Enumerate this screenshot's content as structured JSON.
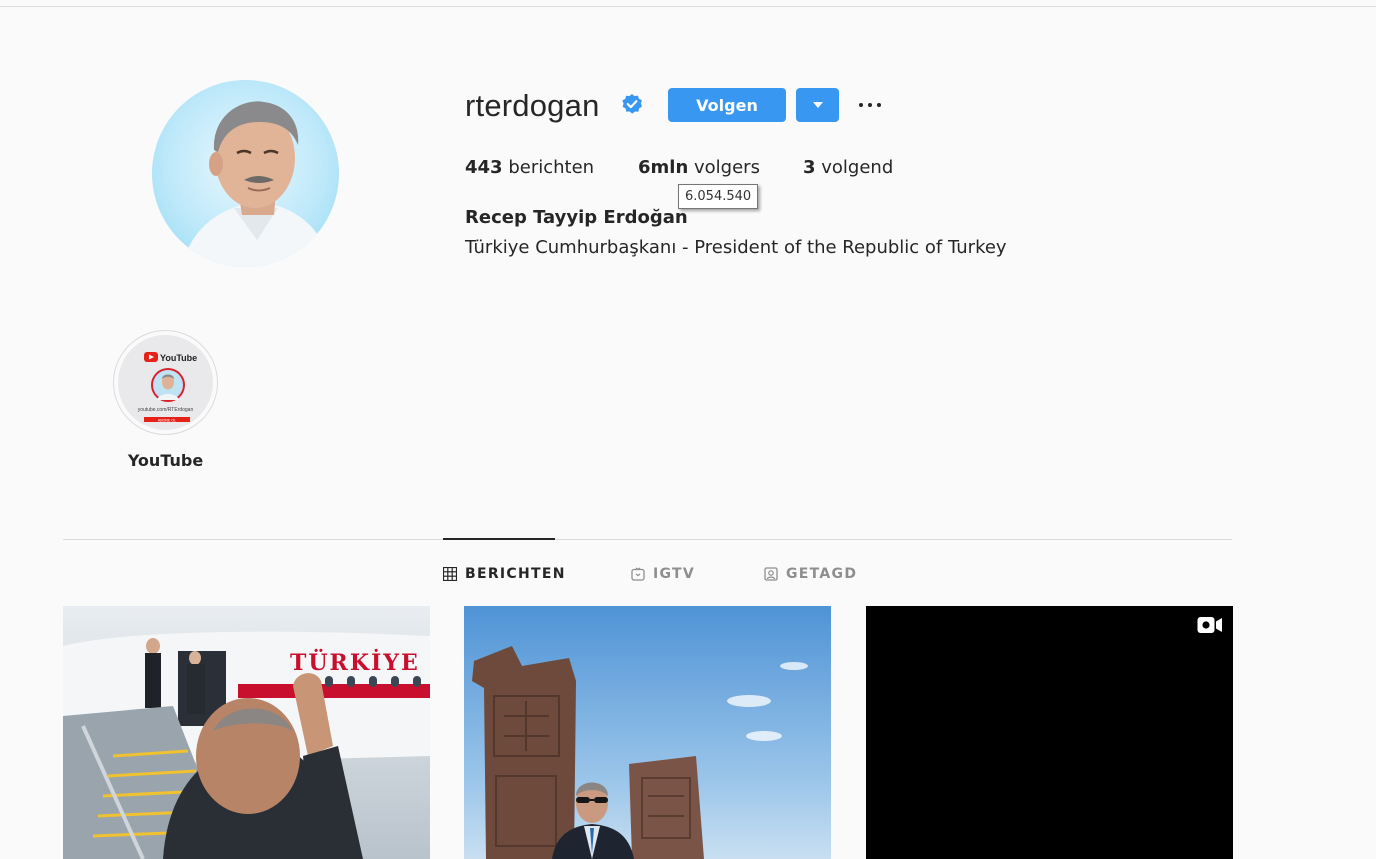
{
  "profile": {
    "username": "rterdogan",
    "verified": true,
    "follow_label": "Volgen",
    "posts_count": "443",
    "posts_label": "berichten",
    "followers_count": "6mln",
    "followers_label": "volgers",
    "followers_tooltip": "6.054.540",
    "following_count": "3",
    "following_label": "volgend",
    "full_name": "Recep Tayyip Erdoğan",
    "bio": "Türkiye Cumhurbaşkanı - President of the Republic of Turkey"
  },
  "highlights": [
    {
      "label": "YouTube",
      "cover_brand": "YouTube",
      "cover_url_text": "youtube.com/RTErdogan",
      "cover_button_text": "ABONE OL"
    }
  ],
  "tabs": [
    {
      "label": "BERICHTEN",
      "icon": "grid-icon",
      "active": true
    },
    {
      "label": "IGTV",
      "icon": "igtv-icon",
      "active": false
    },
    {
      "label": "GETAGD",
      "icon": "tagged-icon",
      "active": false
    }
  ],
  "posts": [
    {
      "kind": "photo",
      "plane_text": "TÜRKİYE"
    },
    {
      "kind": "photo"
    },
    {
      "kind": "video",
      "icon": "video-icon"
    }
  ],
  "colors": {
    "accent": "#3897f0",
    "background": "#fafafa",
    "text": "#262626",
    "muted": "#8e8e8e"
  }
}
